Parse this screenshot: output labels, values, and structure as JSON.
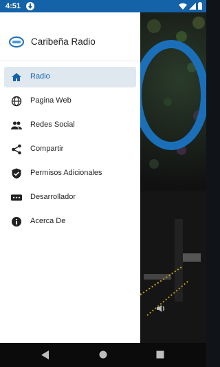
{
  "status_bar": {
    "time": "4:51",
    "bg_color": "#1462a8",
    "icons": [
      "notification-download-icon",
      "wifi-icon",
      "signal-icon",
      "battery-icon"
    ]
  },
  "drawer": {
    "title": "Caribeña Radio",
    "logo": "radio-logo-icon",
    "items": [
      {
        "label": "Radio",
        "icon": "home-icon",
        "active": true
      },
      {
        "label": "Pagina Web",
        "icon": "globe-icon",
        "active": false
      },
      {
        "label": "Redes Social",
        "icon": "people-icon",
        "active": false
      },
      {
        "label": "Compartir",
        "icon": "share-icon",
        "active": false
      },
      {
        "label": "Permisos Adicionales",
        "icon": "shield-check-icon",
        "active": false
      },
      {
        "label": "Desarrollador",
        "icon": "more-dots-icon",
        "active": false
      },
      {
        "label": "Acerca De",
        "icon": "info-icon",
        "active": false
      }
    ],
    "accent_color": "#1462a8",
    "active_bg": "#dfe8ef"
  },
  "background": {
    "icon": "volume-icon"
  },
  "nav_bar": {
    "buttons": [
      "back-icon",
      "home-circle-icon",
      "recents-square-icon"
    ]
  }
}
